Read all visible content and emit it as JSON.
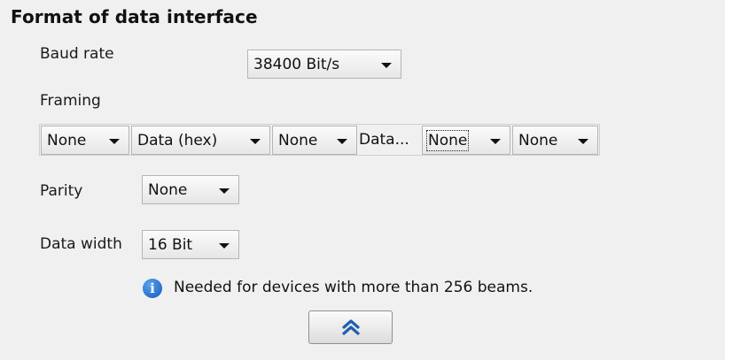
{
  "section": {
    "title": "Format of data interface"
  },
  "baud_rate": {
    "label": "Baud rate",
    "value": "38400 Bit/s"
  },
  "framing": {
    "label": "Framing",
    "items": [
      {
        "value": "None"
      },
      {
        "value": "Data (hex)"
      },
      {
        "value": "None"
      },
      {
        "value": "Data..."
      },
      {
        "value": "None"
      },
      {
        "value": "None"
      }
    ]
  },
  "parity": {
    "label": "Parity",
    "value": "None"
  },
  "data_width": {
    "label": "Data width",
    "value": "16 Bit"
  },
  "info": {
    "icon": "info-icon",
    "text": "Needed for devices with more than 256 beams."
  },
  "collapse_button": {
    "icon": "double-chevron-up-icon",
    "color": "#1f5fb0"
  }
}
